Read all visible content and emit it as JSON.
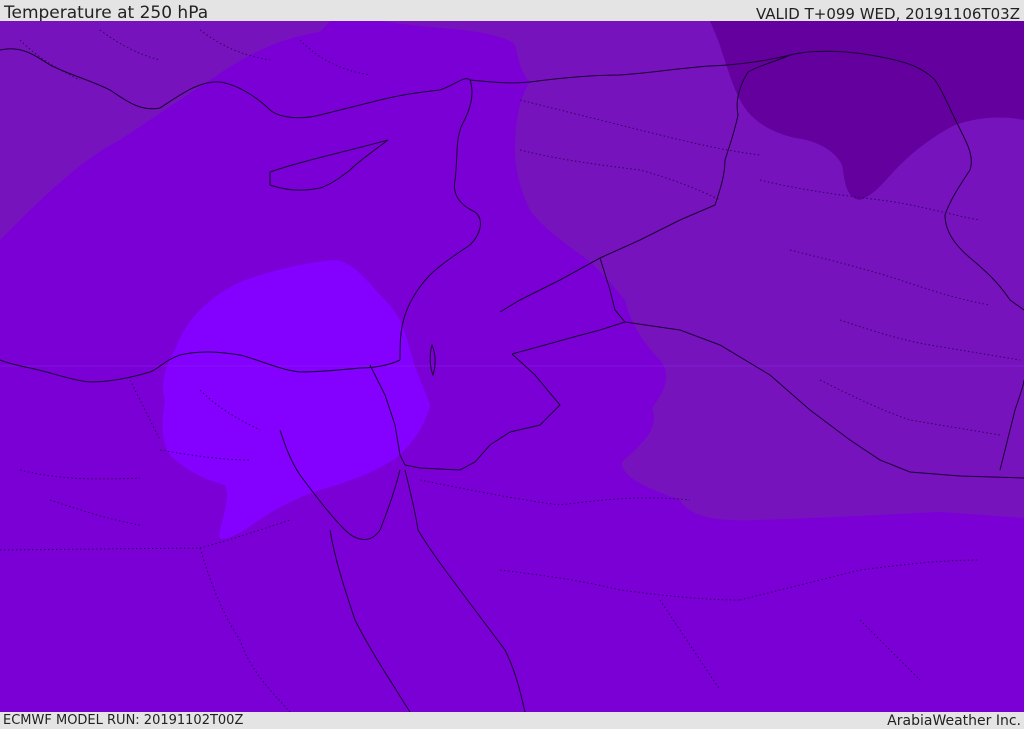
{
  "header": {
    "title": "Temperature at 250 hPa",
    "valid_time": "VALID T+099 WED, 20191106T03Z"
  },
  "footer": {
    "model_run": "ECMWF MODEL RUN: 20191102T00Z",
    "credit": "ArabiaWeather Inc."
  },
  "colors": {
    "base_field": "#7b00d6",
    "cold_band": "#7613bd",
    "coldest_core": "#64009e",
    "warm_blob": "#8400ff",
    "border_line": "#1a0033"
  }
}
